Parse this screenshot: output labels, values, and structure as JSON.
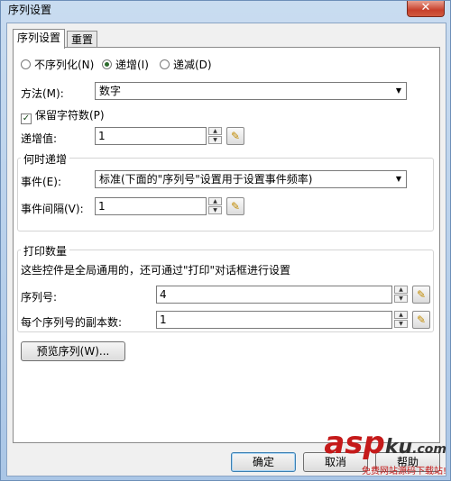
{
  "window": {
    "title": "序列设置",
    "close_glyph": "✕"
  },
  "tabs": [
    {
      "label": "序列设置",
      "active": true
    },
    {
      "label": "重置",
      "active": false
    }
  ],
  "mode": {
    "options": [
      {
        "label": "不序列化(N)",
        "checked": false
      },
      {
        "label": "递增(I)",
        "checked": true
      },
      {
        "label": "递减(D)",
        "checked": false
      }
    ]
  },
  "method": {
    "label": "方法(M):",
    "value": "数字"
  },
  "keep_chars": {
    "label": "保留字符数(P)",
    "checked": true,
    "check_glyph": "✓"
  },
  "increment": {
    "label": "递增值:",
    "value": "1"
  },
  "when_group": {
    "title": "何时递增",
    "event_label": "事件(E):",
    "event_value": "标准(下面的\"序列号\"设置用于设置事件频率)",
    "interval_label": "事件间隔(V):",
    "interval_value": "1"
  },
  "print_group": {
    "title": "打印数量",
    "description": "这些控件是全局通用的，还可通过\"打印\"对话框进行设置",
    "serial_label": "序列号:",
    "serial_value": "4",
    "copies_label": "每个序列号的副本数:",
    "copies_value": "1"
  },
  "preview_button": "预览序列(W)...",
  "footer": {
    "ok": "确定",
    "cancel": "取消",
    "help": "帮助"
  },
  "watermark": {
    "logo": "asp",
    "logo_suffix": "ku",
    "logo_tld": ".com",
    "tagline": "免费网站源码下载站!"
  },
  "icons": {
    "spin_up": "▲",
    "spin_down": "▼",
    "dropdown": "▼",
    "picker": "✎"
  }
}
